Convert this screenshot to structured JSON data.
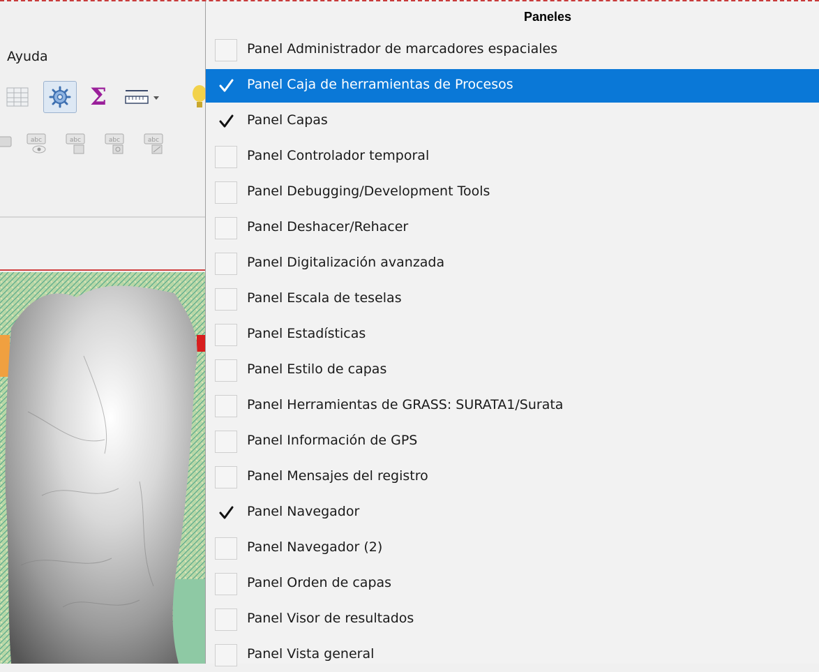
{
  "left_window": {
    "menu_help": "Ayuda"
  },
  "panels_menu": {
    "title": "Paneles",
    "items": [
      {
        "label": "Panel Administrador de marcadores espaciales",
        "checked": false,
        "highlighted": false
      },
      {
        "label": "Panel Caja de herramientas de Procesos",
        "checked": true,
        "highlighted": true
      },
      {
        "label": "Panel Capas",
        "checked": true,
        "highlighted": false
      },
      {
        "label": "Panel Controlador temporal",
        "checked": false,
        "highlighted": false
      },
      {
        "label": "Panel Debugging/Development Tools",
        "checked": false,
        "highlighted": false
      },
      {
        "label": "Panel Deshacer/Rehacer",
        "checked": false,
        "highlighted": false
      },
      {
        "label": "Panel Digitalización avanzada",
        "checked": false,
        "highlighted": false
      },
      {
        "label": "Panel Escala de teselas",
        "checked": false,
        "highlighted": false
      },
      {
        "label": "Panel Estadísticas",
        "checked": false,
        "highlighted": false
      },
      {
        "label": "Panel Estilo de capas",
        "checked": false,
        "highlighted": false
      },
      {
        "label": "Panel Herramientas de GRASS: SURATA1/Surata",
        "checked": false,
        "highlighted": false
      },
      {
        "label": "Panel Información de GPS",
        "checked": false,
        "highlighted": false
      },
      {
        "label": "Panel Mensajes del registro",
        "checked": false,
        "highlighted": false
      },
      {
        "label": "Panel Navegador",
        "checked": true,
        "highlighted": false
      },
      {
        "label": "Panel Navegador (2)",
        "checked": false,
        "highlighted": false
      },
      {
        "label": "Panel Orden de capas",
        "checked": false,
        "highlighted": false
      },
      {
        "label": "Panel Visor de resultados",
        "checked": false,
        "highlighted": false
      },
      {
        "label": "Panel Vista general",
        "checked": false,
        "highlighted": false
      }
    ]
  },
  "colors": {
    "highlight": "#0a78d7",
    "menu_background": "#f2f2f2",
    "sigma": "#9a1f9a"
  },
  "icons": {
    "toolbar": [
      "attribute-table-icon",
      "processing-toolbox-icon",
      "statistics-sigma-icon",
      "measure-ruler-icon",
      "tips-icon"
    ],
    "labels": [
      "label-tool-icon",
      "label-show-icon",
      "label-pin-icon",
      "label-rotate-icon",
      "label-change-icon"
    ],
    "check": "checkmark-icon"
  }
}
